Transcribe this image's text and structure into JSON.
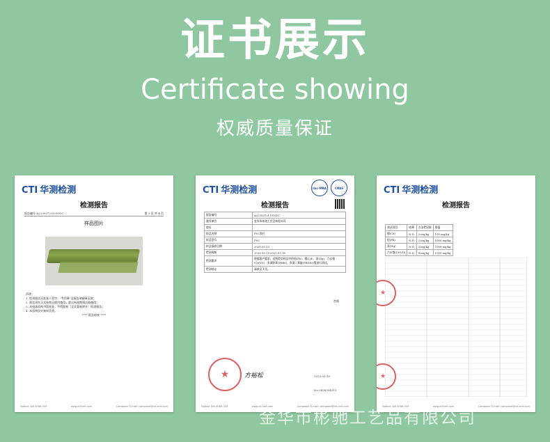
{
  "header": {
    "title_cn": "证书展示",
    "title_en": "Certificate showing",
    "subtitle": "权威质量保证"
  },
  "colors": {
    "background": "#8fc8a0",
    "brand_blue": "#1f4fa0",
    "stamp_red": "#d23c3c"
  },
  "doc1": {
    "logo_cti": "CTI",
    "logo_cn": "华测检测",
    "title": "检测报告",
    "report_no": "报告编号  A2230372119101C",
    "page": "第 3 页  共 4 页",
    "section": "样品图片",
    "notes": [
      "声明：",
      "1. 检测报告无批准人签字、\"专用章\"及报告骑缝章无效；",
      "2. 报告须在正式有效日期内使用，超出有效期限方能使用；",
      "3. 未经本机构书面批准，不得复制（全文复制除外）检测报告；",
      "4. 本机构仅对来样负责。",
      "****  报告结束  ****"
    ],
    "footer_left": "Hotline 400-6788-333",
    "footer_mid": "www.cti-cert.com",
    "footer_right": "Complaint E-mail: complaint@cti-cert.com"
  },
  "doc2": {
    "logo_cti": "CTI",
    "logo_cn": "华测检测",
    "badge1": "ilac-MRA",
    "badge2": "CNAS",
    "title": "检测报告",
    "rows": [
      [
        "报告编号",
        "A2230372119101C"
      ],
      [
        "委托单位",
        "金华市彬驰工艺品有限公司"
      ],
      [
        "地址",
        ""
      ],
      [
        "样品名称",
        "PVC胶片"
      ],
      [
        "样品型号",
        "PVC"
      ],
      [
        "样品接收日期",
        "2023.03.13"
      ],
      [
        "检测周期",
        "2023.03.13-2023.03.18"
      ],
      [
        "检测要求",
        "根据客户要求，对所提交样品中的铅(Pb)、镉(Cd)、汞(Hg)、六价铬(Cr(VI))、多溴联苯(PBBs)、多溴二苯醚(PBDEs)等进行测试。"
      ],
      [
        "检测结论",
        "请参见下页。"
      ]
    ],
    "conclusion": "合格",
    "sign": "方裕松",
    "date": "2023.03.18",
    "report_no2": "No.5428354315"
  },
  "doc3": {
    "logo_cti": "CTI",
    "logo_cn": "华测检测",
    "title": "检测报告",
    "col_headers": [
      "测试项目",
      "结果",
      "方法检出限",
      "限值"
    ],
    "rows": [
      [
        "镉(Cd)",
        "N.D.",
        "2 mg/kg",
        "100 mg/kg"
      ],
      [
        "铅(Pb)",
        "N.D.",
        "2 mg/kg",
        "1000 mg/kg"
      ],
      [
        "汞(Hg)",
        "N.D.",
        "2 mg/kg",
        "1000 mg/kg"
      ],
      [
        "六价铬(Cr(VI))",
        "N.D.",
        "8 mg/kg",
        "1000 mg/kg"
      ]
    ]
  },
  "watermark": "金华市彬驰工艺品有限公司"
}
